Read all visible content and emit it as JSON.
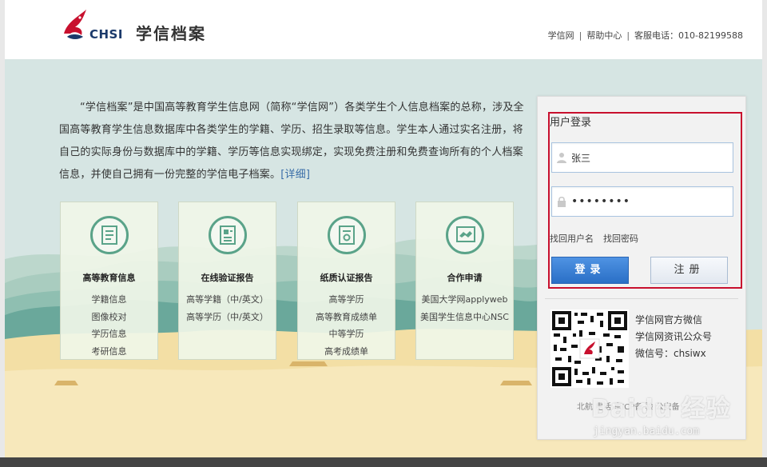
{
  "header": {
    "logo_text": "CHSI",
    "site_title": "学信档案",
    "links": [
      "学信网",
      "帮助中心"
    ],
    "separator": "|",
    "hotline": "客服电话：010-82199588"
  },
  "intro": {
    "text": "“学信档案”是中国高等教育学生信息网（简称“学信网”）各类学生个人信息档案的总称，涉及全国高等教育学生信息数据库中各类学生的学籍、学历、招生录取等信息。学生本人通过实名注册，将自己的实际身份与数据库中的学籍、学历等信息实现绑定，实现免费注册和免费查询所有的个人档案信息，并使自己拥有一份完整的学信电子档案。",
    "more": "[详细]"
  },
  "cards": [
    {
      "title": "高等教育信息",
      "icon": "document-list-icon",
      "items": [
        "学籍信息",
        "图像校对",
        "学历信息",
        "考研信息"
      ]
    },
    {
      "title": "在线验证报告",
      "icon": "report-verify-icon",
      "items": [
        "高等学籍（中/英文）",
        "高等学历（中/英文）"
      ]
    },
    {
      "title": "纸质认证报告",
      "icon": "certificate-icon",
      "items": [
        "高等学历",
        "高等教育成绩单",
        "中等学历",
        "高考成绩单"
      ]
    },
    {
      "title": "合作申请",
      "icon": "handshake-icon",
      "items": [
        "美国大学网applyweb",
        "美国学生信息中心NSC"
      ]
    }
  ],
  "login": {
    "title": "用户登录",
    "username_value": "张三",
    "password_value": "••••••••",
    "forgot_username": "找回用户名",
    "forgot_password": "找回密码",
    "login_button": "登录",
    "register_button": "注册"
  },
  "wechat": {
    "line1": "学信网官方微信",
    "line2": "学信网资讯公众号",
    "line3": "微信号：chsiwx"
  },
  "footer": {
    "text": "北航  电话  京ICP备  验  公安备"
  },
  "watermark": {
    "main": "Baidu 经验",
    "sub": "jingyan.baidu.com"
  },
  "colors": {
    "brand_red": "#c8102e",
    "brand_navy": "#1b3a6b",
    "accent_green": "#5aa389",
    "login_blue": "#2a6fc6",
    "hero_bg": "#d6e5e3",
    "sand": "#f3dfa5"
  }
}
